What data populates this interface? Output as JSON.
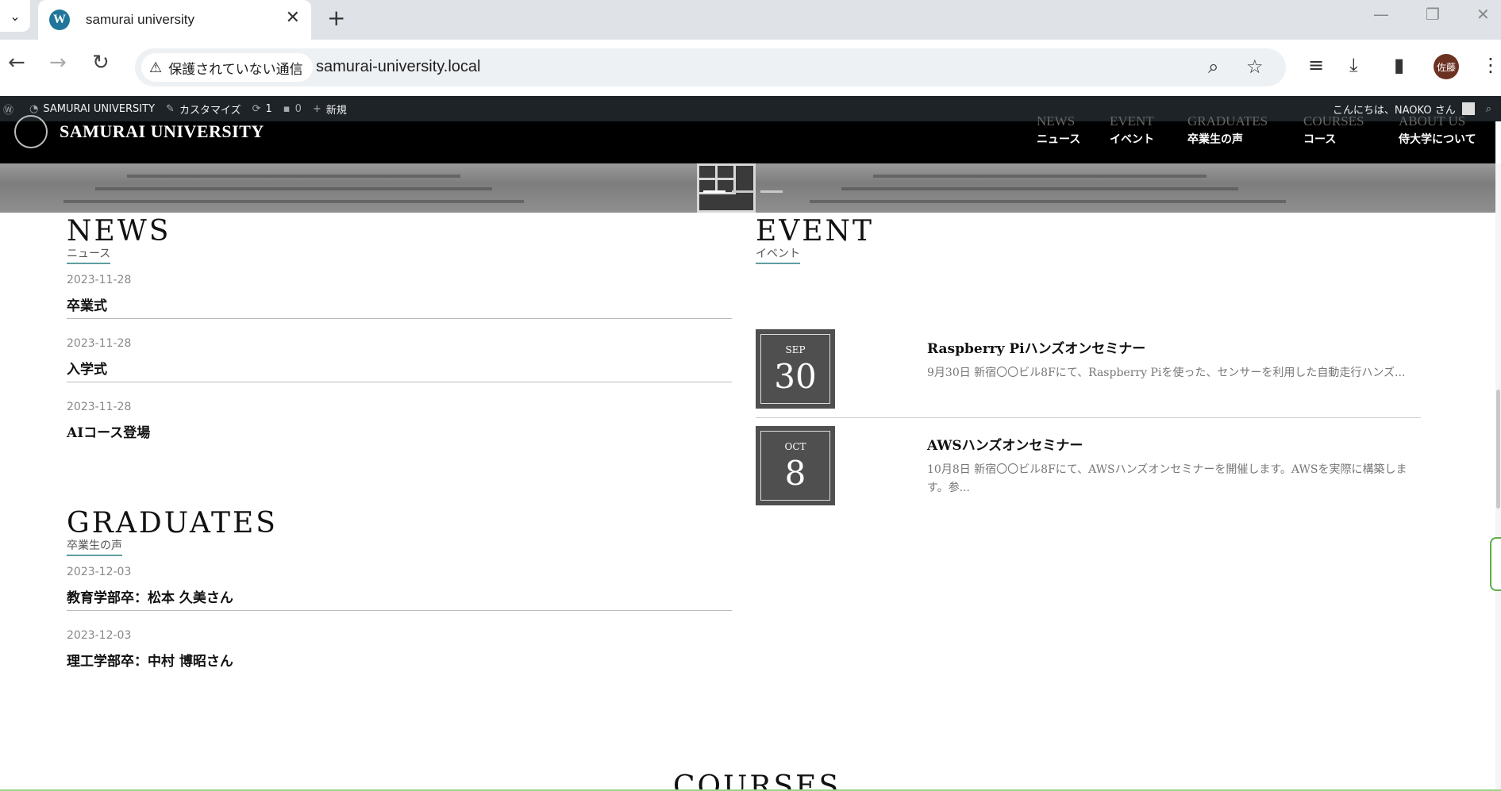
{
  "browser": {
    "tab_title": "samurai university",
    "security_label": "保護されていない通信",
    "url": "samurai-university.local",
    "avatar_text": "佐藤"
  },
  "admin_bar": {
    "site_name": "SAMURAI UNIVERSITY",
    "customize": "カスタマイズ",
    "updates_count": "1",
    "comments_count": "0",
    "new_label": "新規",
    "greeting": "こんにちは、NAOKO さん"
  },
  "site": {
    "title": "SAMURAI UNIVERSITY",
    "nav": [
      {
        "en": "NEWS",
        "ja": "ニュース"
      },
      {
        "en": "EVENT",
        "ja": "イベント"
      },
      {
        "en": "GRADUATES",
        "ja": "卒業生の声"
      },
      {
        "en": "COURSES",
        "ja": "コース"
      },
      {
        "en": "ABOUT US",
        "ja": "侍大学について"
      }
    ]
  },
  "news": {
    "title": "NEWS",
    "subtitle": "ニュース",
    "posts": [
      {
        "date": "2023-11-28",
        "title": "卒業式"
      },
      {
        "date": "2023-11-28",
        "title": "入学式"
      },
      {
        "date": "2023-11-28",
        "title": "AIコース登場"
      }
    ]
  },
  "event": {
    "title": "EVENT",
    "subtitle": "イベント",
    "items": [
      {
        "month": "SEP",
        "day": "30",
        "title": "Raspberry Piハンズオンセミナー",
        "excerpt": "9月30日 新宿〇〇ビル8Fにて、Raspberry Piを使った、センサーを利用した自動走行ハンズ..."
      },
      {
        "month": "OCT",
        "day": "8",
        "title": "AWSハンズオンセミナー",
        "excerpt": "10月8日 新宿〇〇ビル8Fにて、AWSハンズオンセミナーを開催します。AWSを実際に構築します。参..."
      }
    ]
  },
  "graduates": {
    "title": "GRADUATES",
    "subtitle": "卒業生の声",
    "posts": [
      {
        "date": "2023-12-03",
        "title": "教育学部卒：松本 久美さん"
      },
      {
        "date": "2023-12-03",
        "title": "理工学部卒：中村 博昭さん"
      }
    ]
  },
  "courses_peek": "COURSES"
}
